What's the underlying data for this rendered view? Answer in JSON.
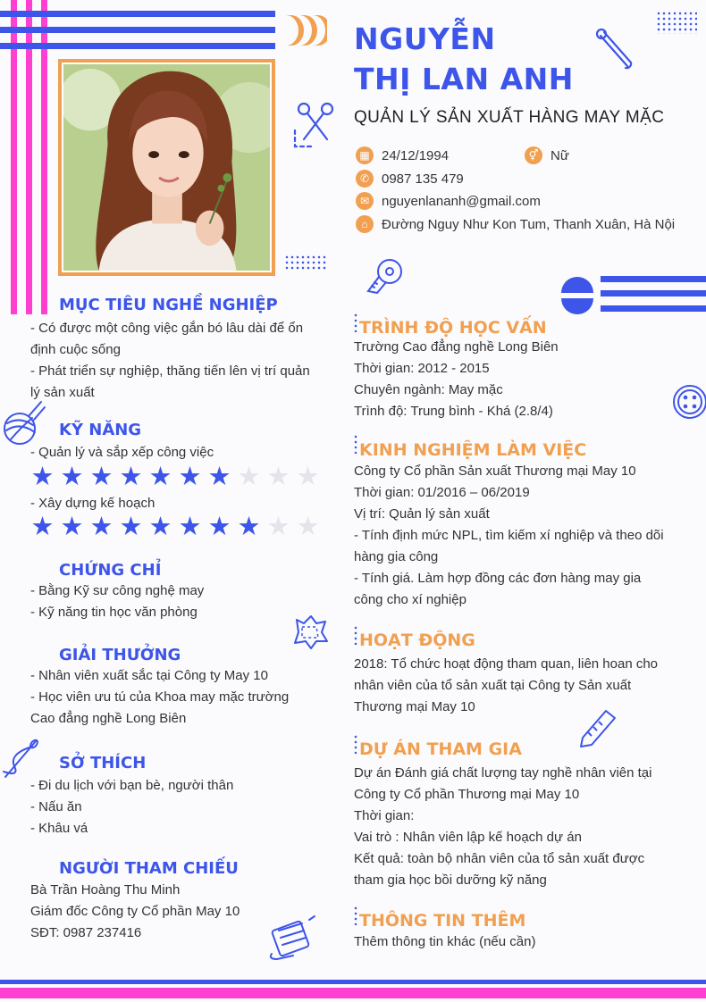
{
  "colors": {
    "accent_blue": "#3d55e8",
    "accent_pink": "#ff3fd0",
    "accent_orange": "#f0a050"
  },
  "header": {
    "name_line1": "NGUYỄN",
    "name_line2": "THỊ LAN ANH",
    "job_title": "QUẢN LÝ SẢN XUẤT HÀNG MAY MẶC"
  },
  "contact": {
    "birthday": "24/12/1994",
    "gender": "Nữ",
    "phone": "0987 135 479",
    "email": "nguyenlananh@gmail.com",
    "address": "Đường Nguy Như Kon Tum, Thanh Xuân, Hà Nội",
    "icons": [
      "calendar-icon",
      "gender-icon",
      "phone-icon",
      "email-icon",
      "home-icon"
    ]
  },
  "objective": {
    "title": "MỤC TIÊU NGHỀ NGHIỆP",
    "lines": [
      "- Có được một công việc gắn bó lâu dài để ổn",
      "định cuộc sống",
      "- Phát triển sự nghiệp, thăng tiến lên vị trí quản",
      "lý sản xuất"
    ]
  },
  "skills": {
    "title": "KỸ NĂNG",
    "items": [
      {
        "label": "- Quản lý và sắp xếp công việc",
        "rating": 7,
        "max": 10
      },
      {
        "label": "- Xây dựng kế hoạch",
        "rating": 8,
        "max": 10
      }
    ]
  },
  "certificates": {
    "title": "CHỨNG CHỈ",
    "lines": [
      "- Bằng Kỹ sư công nghệ may",
      "- Kỹ năng tin học văn phòng"
    ]
  },
  "awards": {
    "title": "GIẢI THƯỞNG",
    "lines": [
      "- Nhân viên xuất sắc tại Công ty May 10",
      "- Học viên ưu tú của Khoa may mặc trường",
      "Cao đẳng nghề Long Biên"
    ]
  },
  "hobbies": {
    "title": "SỞ THÍCH",
    "lines": [
      "- Đi du lịch với bạn bè, người thân",
      "- Nấu ăn",
      "- Khâu vá"
    ]
  },
  "reference": {
    "title": "NGƯỜI THAM CHIẾU",
    "lines": [
      "Bà Trần Hoàng Thu Minh",
      "Giám đốc Công ty Cổ phần May 10",
      "SĐT: 0987 237416"
    ]
  },
  "education": {
    "title": "TRÌNH ĐỘ HỌC VẤN",
    "lines": [
      "Trường Cao đẳng nghề Long Biên",
      "Thời gian: 2012 - 2015",
      "Chuyên ngành: May mặc",
      "Trình độ: Trung bình - Khá (2.8/4)"
    ]
  },
  "experience": {
    "title": "KINH NGHIỆM LÀM VIỆC",
    "lines": [
      "Công ty Cổ phần Sản xuất Thương mại May 10",
      "Thời gian: 01/2016 – 06/2019",
      "Vị trí: Quản lý sản xuất",
      "- Tính định mức NPL, tìm kiếm xí nghiệp và theo dõi",
      "hàng gia công",
      "- Tính giá. Làm hợp đồng các đơn hàng may gia",
      "công cho xí nghiệp"
    ]
  },
  "activities": {
    "title": "HOẠT ĐỘNG",
    "lines": [
      "2018: Tổ chức hoạt động tham quan, liên hoan cho",
      "nhân viên của tổ sản xuất tại Công ty Sản xuất",
      "Thương mại May 10"
    ]
  },
  "projects": {
    "title": "DỰ ÁN THAM GIA",
    "lines": [
      "Dự án Đánh giá chất lượng tay nghề nhân viên tại",
      "Công ty Cổ phần Thương mại May 10",
      "Thời gian:",
      "Vai trò : Nhân viên lập kế hoạch dự án",
      "Kết quả: toàn bộ nhân viên của tổ sản xuất được",
      "tham gia học bồi dưỡng kỹ năng"
    ]
  },
  "more_info": {
    "title": "THÔNG TIN THÊM",
    "lines": [
      "Thêm thông tin khác (nếu cần)"
    ]
  }
}
